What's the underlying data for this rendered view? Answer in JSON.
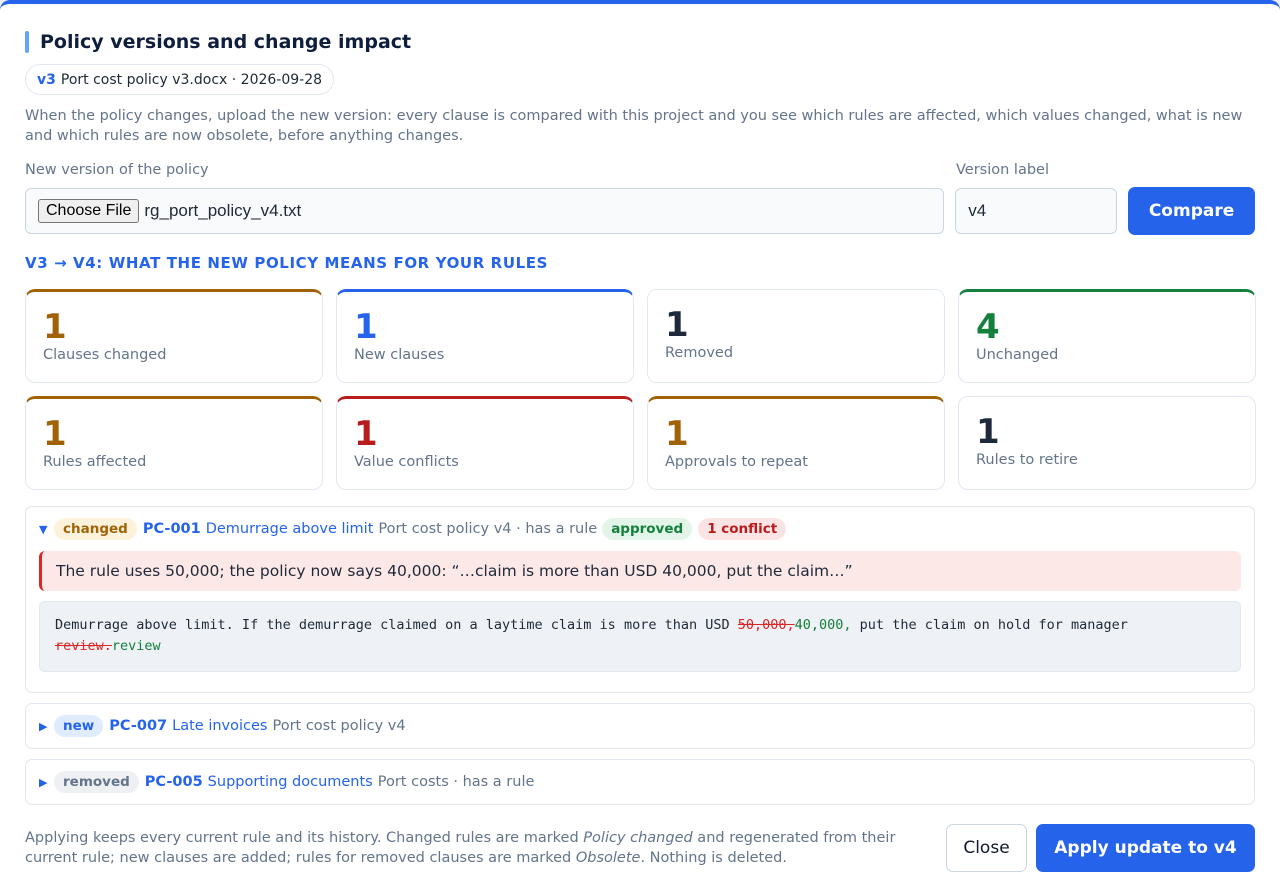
{
  "dialog": {
    "title": "Policy versions and change impact",
    "current_version": {
      "label": "v3",
      "file": "Port cost policy v3.docx · 2026-09-28"
    },
    "intro": "When the policy changes, upload the new version: every clause is compared with this project and you see which rules are affected, which values changed, what is new and which rules are now obsolete, before anything changes."
  },
  "form": {
    "file_label": "New version of the policy",
    "file_button": "Choose File",
    "file_name": "rg_port_policy_v4.txt",
    "version_label": "Version label",
    "version_value": "v4",
    "compare_button": "Compare"
  },
  "summary": {
    "title": "v3 → v4: what the new policy means for your rules",
    "cards": [
      {
        "value": "1",
        "label": "Clauses changed",
        "color": "#a16207"
      },
      {
        "value": "1",
        "label": "New clauses",
        "color": "#2563eb"
      },
      {
        "value": "1",
        "label": "Removed",
        "color": "#1e293b"
      },
      {
        "value": "4",
        "label": "Unchanged",
        "color": "#15803d"
      },
      {
        "value": "1",
        "label": "Rules affected",
        "color": "#a16207"
      },
      {
        "value": "1",
        "label": "Value conflicts",
        "color": "#b91c1c"
      },
      {
        "value": "1",
        "label": "Approvals to repeat",
        "color": "#a16207"
      },
      {
        "value": "1",
        "label": "Rules to retire",
        "color": "#1e293b"
      }
    ]
  },
  "items": [
    {
      "expanded": true,
      "badge": "changed",
      "id": "PC-001",
      "name": "Demurrage above limit",
      "meta": "Port cost policy v4 · has a rule",
      "status": "approved",
      "conflict": "1 conflict",
      "conflict_text": "The rule uses 50,000; the policy now says 40,000: “…claim is more than USD 40,000, put the claim…”",
      "diff": {
        "prefix": "Demurrage above limit. If the demurrage claimed on a laytime claim is more than USD ",
        "del1": "50,000,",
        "ins1": "40,000,",
        "middle": " put the claim on hold for manager ",
        "del2": "review.",
        "ins2": "review"
      }
    },
    {
      "expanded": false,
      "badge": "new",
      "id": "PC-007",
      "name": "Late invoices",
      "meta": "Port cost policy v4"
    },
    {
      "expanded": false,
      "badge": "removed",
      "id": "PC-005",
      "name": "Supporting documents",
      "meta": "Port costs · has a rule"
    }
  ],
  "footer": {
    "text_a": "Applying keeps every current rule and its history. Changed rules are marked ",
    "em_a": "Policy changed",
    "text_b": " and regenerated from their current rule; new clauses are added; rules for removed clauses are marked ",
    "em_b": "Obsolete",
    "text_c": ". Nothing is deleted.",
    "close_button": "Close",
    "apply_button": "Apply update to v4"
  }
}
